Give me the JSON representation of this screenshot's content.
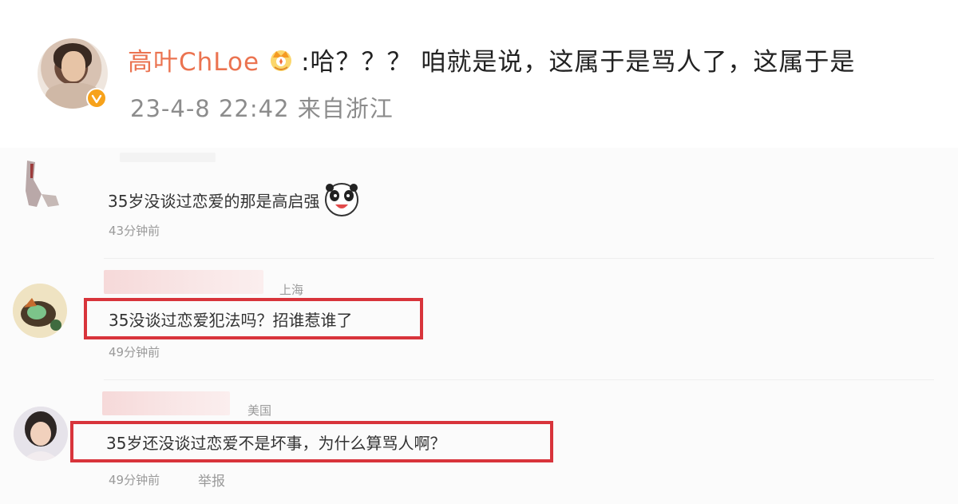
{
  "post": {
    "username": "高叶ChLoe",
    "text": ":哈？？？ 咱就是说，这属于是骂人了，这属于是",
    "timestamp": "23-4-8 22:42",
    "source": "来自浙江"
  },
  "comments": [
    {
      "text": "35岁没谈过恋爱的那是高启强",
      "time": "43分钟前"
    },
    {
      "location": "上海",
      "text": "35没谈过恋爱犯法吗？招谁惹谁了",
      "time": "49分钟前"
    },
    {
      "location": "美国",
      "text": "35岁还没谈过恋爱不是坏事，为什么算骂人啊？",
      "time": "49分钟前",
      "report_label": "举报"
    }
  ],
  "colors": {
    "username": "#eb7350",
    "highlight_border": "#d8343b",
    "verified_badge": "#f7a21b",
    "meta_text": "#8c8c8c"
  },
  "icons": {
    "verified": "verified-badge-icon",
    "crown": "crown-icon",
    "emoji": "panda-laugh-emoji-icon"
  }
}
